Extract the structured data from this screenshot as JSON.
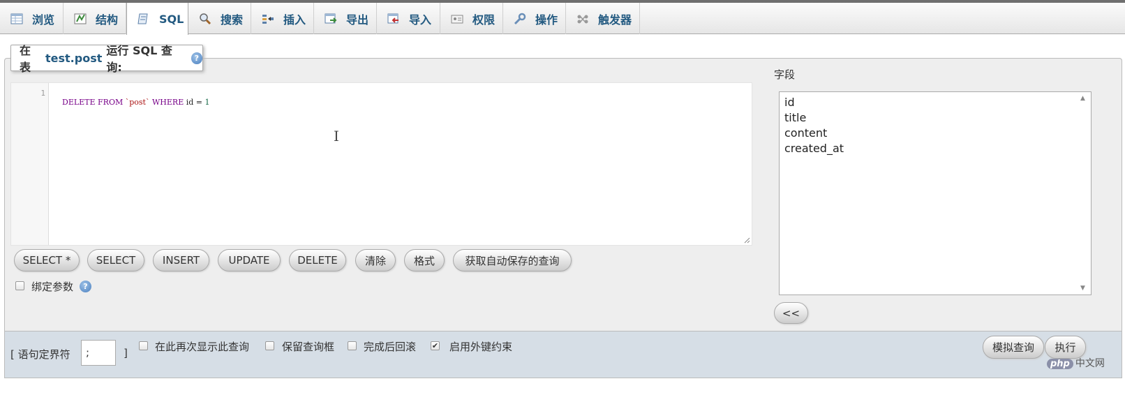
{
  "tabs": [
    {
      "label": "浏览",
      "icon": "table-browse-icon",
      "active": false
    },
    {
      "label": "结构",
      "icon": "structure-icon",
      "active": false
    },
    {
      "label": "SQL",
      "icon": "sql-icon",
      "active": true
    },
    {
      "label": "搜索",
      "icon": "magnifier-icon",
      "active": false
    },
    {
      "label": "插入",
      "icon": "insert-row-icon",
      "active": false
    },
    {
      "label": "导出",
      "icon": "export-icon",
      "active": false
    },
    {
      "label": "导入",
      "icon": "import-icon",
      "active": false
    },
    {
      "label": "权限",
      "icon": "privileges-icon",
      "active": false
    },
    {
      "label": "操作",
      "icon": "wrench-icon",
      "active": false
    },
    {
      "label": "触发器",
      "icon": "triggers-icon",
      "active": false
    }
  ],
  "legend": {
    "prefix": "在表",
    "table": "test.post",
    "suffix": "运行 SQL 查询:"
  },
  "editor": {
    "line_number": "1",
    "tokens": [
      {
        "text": "DELETE FROM ",
        "cls": "kw"
      },
      {
        "text": "`post`",
        "cls": "str"
      },
      {
        "text": " WHERE ",
        "cls": "kw"
      },
      {
        "text": "id = ",
        "cls": ""
      },
      {
        "text": "1",
        "cls": "num"
      }
    ]
  },
  "buttons": [
    "SELECT *",
    "SELECT",
    "INSERT",
    "UPDATE",
    "DELETE",
    "清除",
    "格式",
    "获取自动保存的查询"
  ],
  "bind_params_label": "绑定参数",
  "fields": {
    "title": "字段",
    "items": [
      "id",
      "title",
      "content",
      "created_at"
    ],
    "insert_button": "<<"
  },
  "bottom": {
    "delimiter_label": "[ 语句定界符",
    "delimiter_value": ";",
    "delimiter_close": "]",
    "options": [
      {
        "label": "在此再次显示此查询",
        "checked": false
      },
      {
        "label": "保留查询框",
        "checked": false
      },
      {
        "label": "完成后回滚",
        "checked": false
      },
      {
        "label": "启用外键约束",
        "checked": true
      }
    ],
    "simulate_button": "模拟查询",
    "go_button": "执行"
  },
  "watermark": {
    "brand": "php",
    "site": "中文网"
  },
  "colors": {
    "accent": "#235a81",
    "panel": "#eeeeee",
    "bottom_bar": "#d6dee6"
  }
}
